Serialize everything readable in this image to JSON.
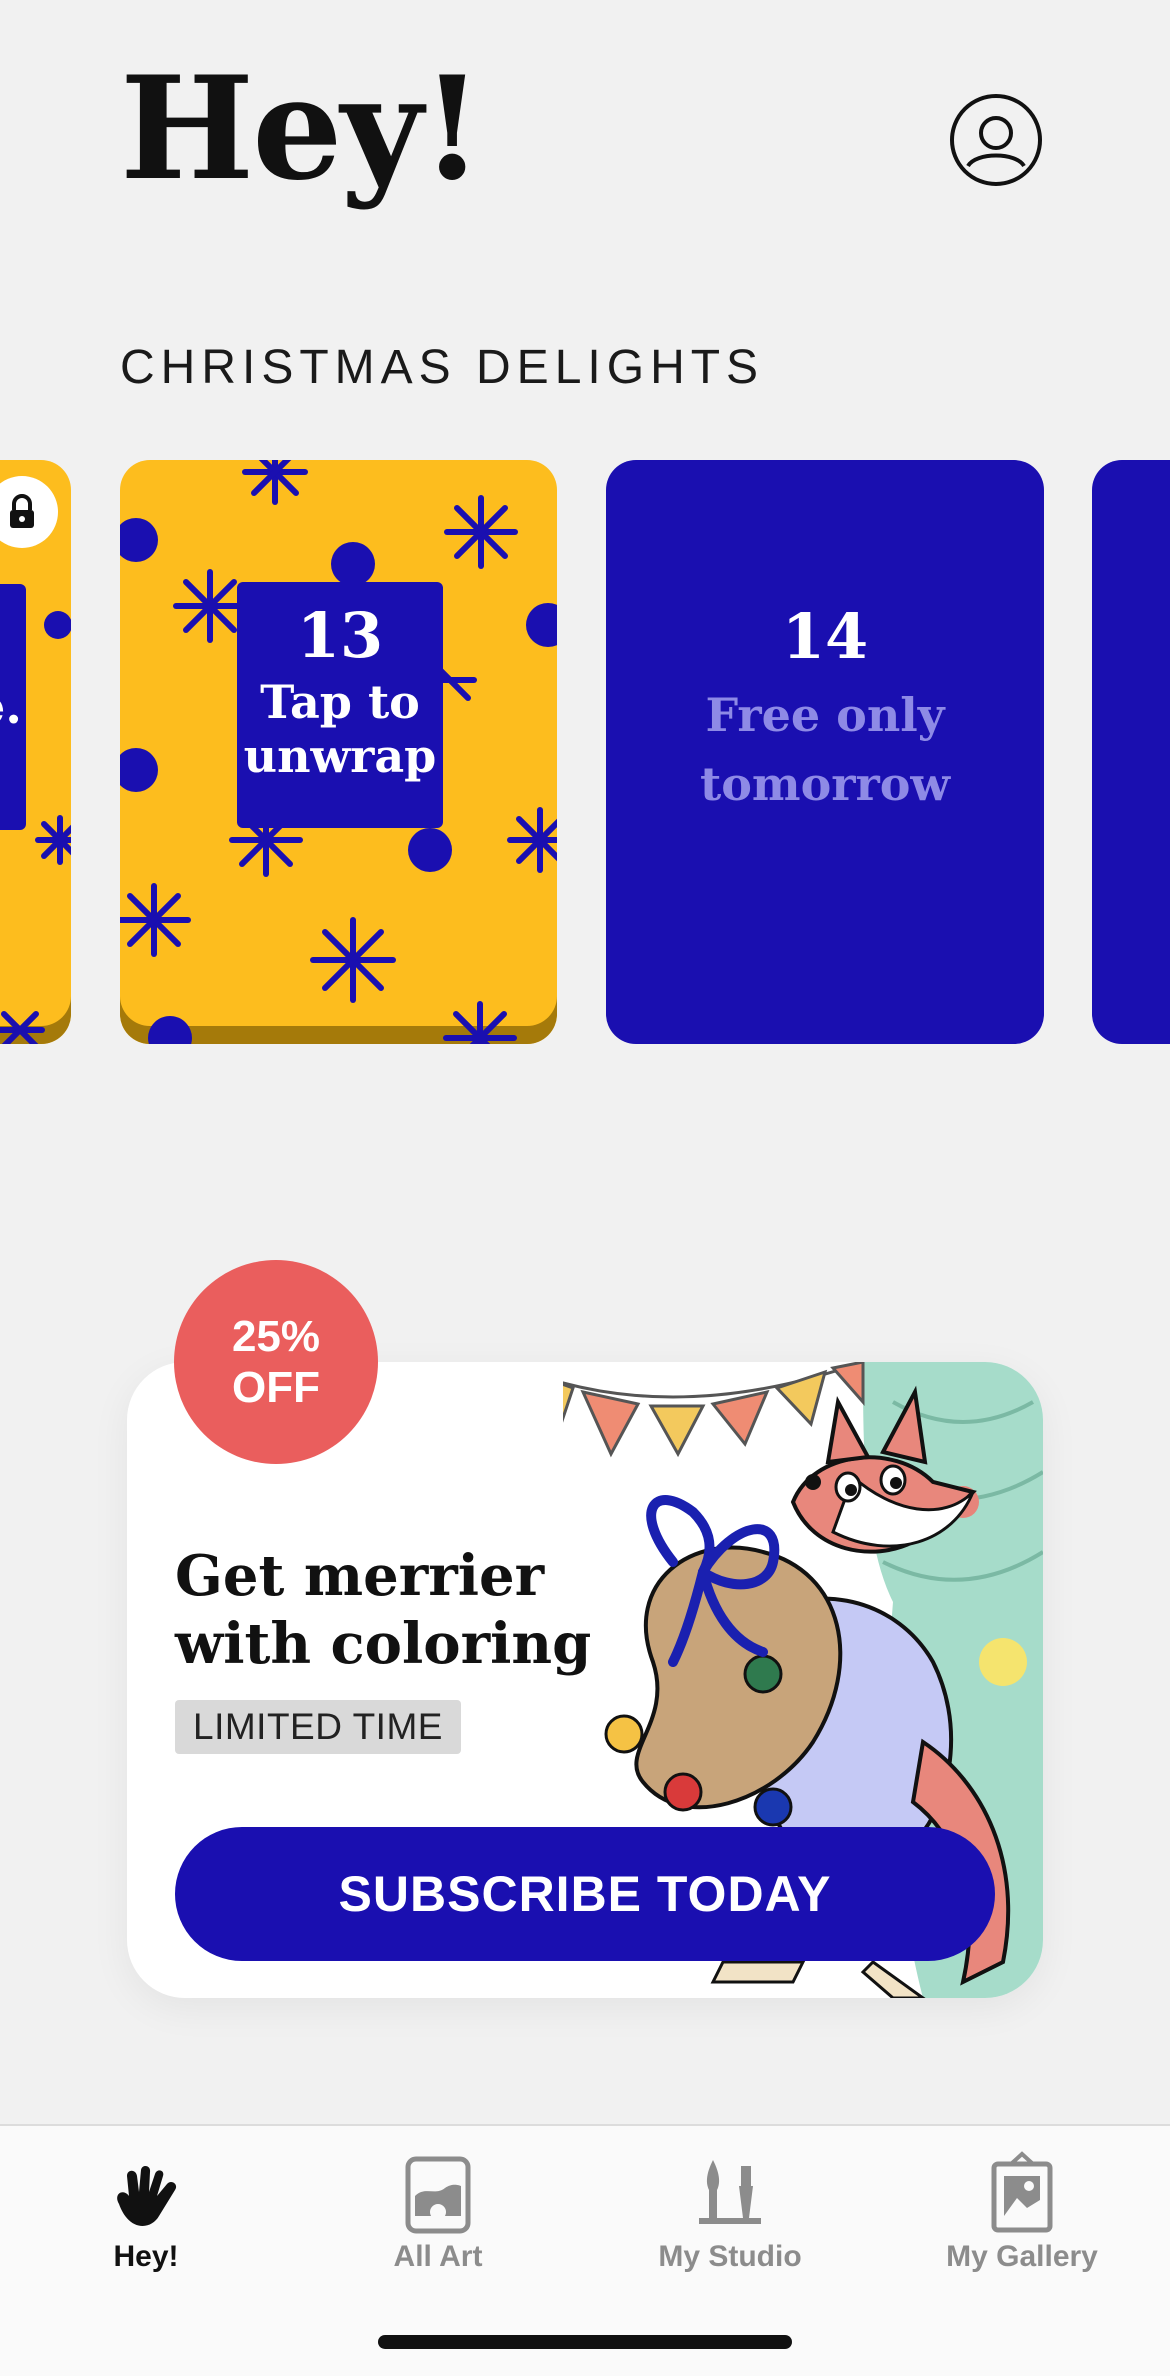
{
  "header": {
    "title": "Hey!",
    "profile_icon": "user-circle-icon"
  },
  "section": {
    "title": "CHRISTMAS DELIGHTS"
  },
  "cards": [
    {
      "day": "",
      "label": "e.",
      "state": "unwrapped",
      "icon": "lock-icon"
    },
    {
      "day": "13",
      "label": "Tap to unwrap",
      "label_line1": "Tap to",
      "label_line2": "unwrap",
      "state": "available"
    },
    {
      "day": "14",
      "label_line1": "Free only",
      "label_line2": "tomorrow",
      "state": "locked"
    }
  ],
  "promo": {
    "discount_line1": "25%",
    "discount_line2": "OFF",
    "title_line1": "Get merrier",
    "title_line2": "with coloring",
    "badge": "LIMITED TIME",
    "cta": "SUBSCRIBE TODAY"
  },
  "tabs": [
    {
      "label": "Hey!",
      "icon": "waving-hand-icon",
      "active": true
    },
    {
      "label": "All Art",
      "icon": "picture-frame-icon",
      "active": false
    },
    {
      "label": "My Studio",
      "icon": "brushes-icon",
      "active": false
    },
    {
      "label": "My Gallery",
      "icon": "gallery-icon",
      "active": false
    }
  ],
  "colors": {
    "background": "#f1f1f1",
    "accent_blue": "#1a0fb0",
    "card_yellow": "#fdbd1e",
    "discount_red": "#ea5e5d",
    "muted_lilac": "#8e8ae6"
  }
}
